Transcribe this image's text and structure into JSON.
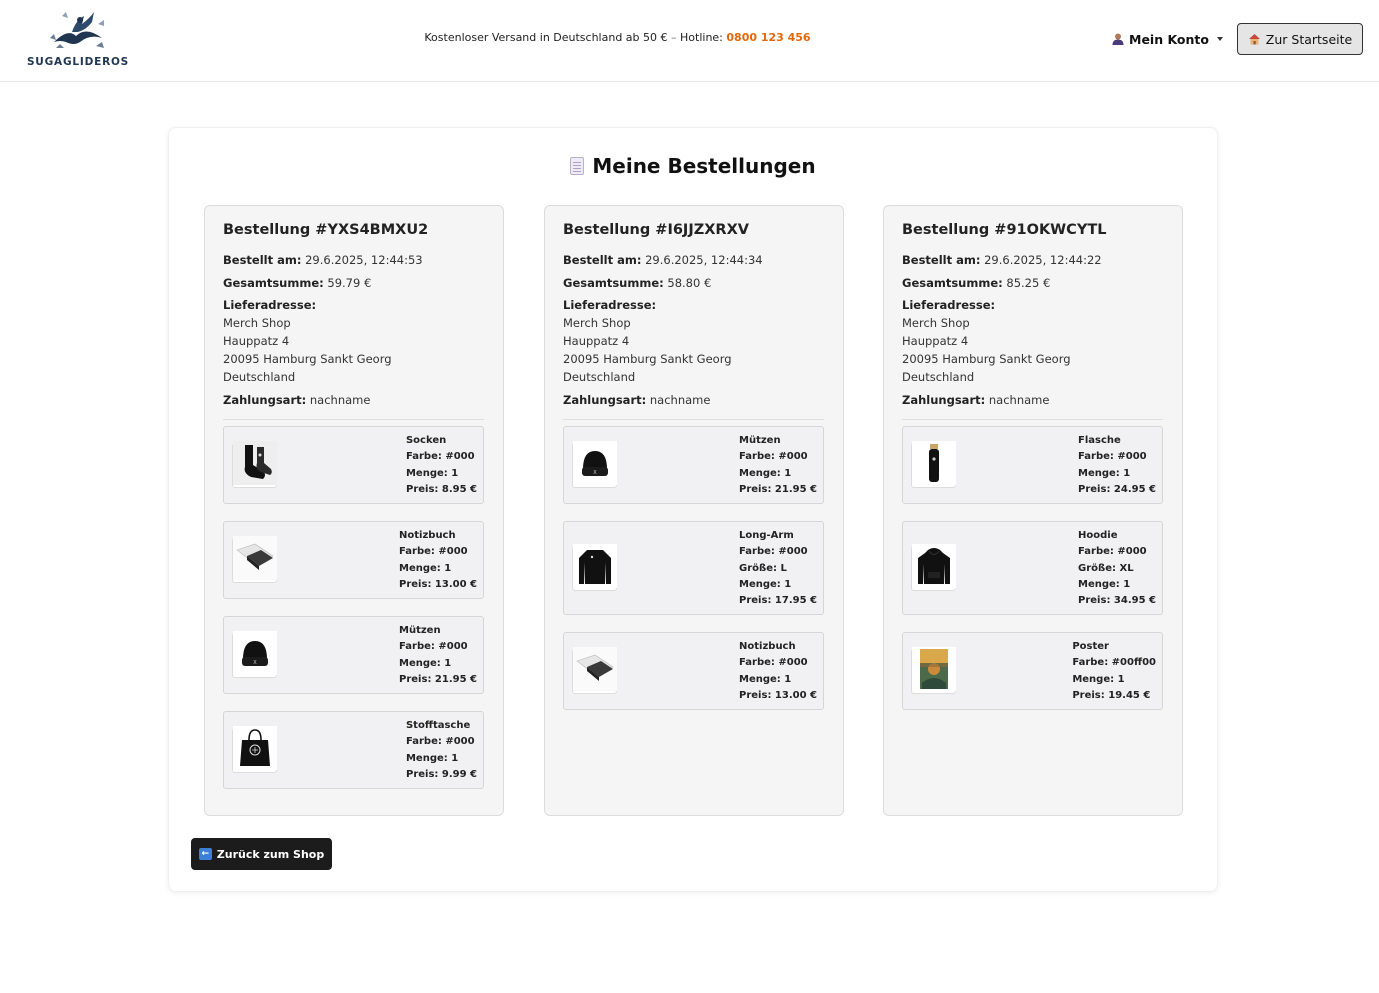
{
  "header": {
    "logo_text": "SUGAGLIDEROS",
    "shipping_text": "Kostenloser Versand in Deutschland ab 50 €",
    "separator": "–",
    "hotline_label": "Hotline:",
    "hotline_number": "0800 123 456",
    "account_label": "Mein Konto",
    "home_button_label": "Zur Startseite"
  },
  "page": {
    "title": "Meine Bestellungen",
    "back_button_label": "Zurück zum Shop"
  },
  "labels": {
    "ordered_at": "Bestellt am:",
    "total": "Gesamtsumme:",
    "address": "Lieferadresse:",
    "payment": "Zahlungsart:"
  },
  "orders": [
    {
      "title": "Bestellung #YXS4BMXU2",
      "ordered_at": "29.6.2025, 12:44:53",
      "total": "59.79 €",
      "address": [
        "Merch Shop",
        "Hauppatz 4",
        "20095 Hamburg Sankt Georg",
        "Deutschland"
      ],
      "payment": "nachname",
      "items": [
        {
          "name": "Socken",
          "farbe": "Farbe: #000",
          "menge": "Menge: 1",
          "preis": "Preis: 8.95 €",
          "icon": "socks-icon"
        },
        {
          "name": "Notizbuch",
          "farbe": "Farbe: #000",
          "menge": "Menge: 1",
          "preis": "Preis: 13.00 €",
          "icon": "notebook-icon"
        },
        {
          "name": "Mützen",
          "farbe": "Farbe: #000",
          "menge": "Menge: 1",
          "preis": "Preis: 21.95 €",
          "icon": "beanie-icon"
        },
        {
          "name": "Stofftasche",
          "farbe": "Farbe: #000",
          "menge": "Menge: 1",
          "preis": "Preis: 9.99 €",
          "icon": "tote-bag-icon"
        }
      ]
    },
    {
      "title": "Bestellung #I6JJZXRXV",
      "ordered_at": "29.6.2025, 12:44:34",
      "total": "58.80 €",
      "address": [
        "Merch Shop",
        "Hauppatz 4",
        "20095 Hamburg Sankt Georg",
        "Deutschland"
      ],
      "payment": "nachname",
      "items": [
        {
          "name": "Mützen",
          "farbe": "Farbe: #000",
          "menge": "Menge: 1",
          "preis": "Preis: 21.95 €",
          "icon": "beanie-icon"
        },
        {
          "name": "Long-Arm",
          "farbe": "Farbe: #000",
          "groesse": "Größe: L",
          "menge": "Menge: 1",
          "preis": "Preis: 17.95 €",
          "icon": "longsleeve-icon"
        },
        {
          "name": "Notizbuch",
          "farbe": "Farbe: #000",
          "menge": "Menge: 1",
          "preis": "Preis: 13.00 €",
          "icon": "notebook-icon"
        }
      ]
    },
    {
      "title": "Bestellung #91OKWCYTL",
      "ordered_at": "29.6.2025, 12:44:22",
      "total": "85.25 €",
      "address": [
        "Merch Shop",
        "Hauppatz 4",
        "20095 Hamburg Sankt Georg",
        "Deutschland"
      ],
      "payment": "nachname",
      "items": [
        {
          "name": "Flasche",
          "farbe": "Farbe: #000",
          "menge": "Menge: 1",
          "preis": "Preis: 24.95 €",
          "icon": "bottle-icon"
        },
        {
          "name": "Hoodie",
          "farbe": "Farbe: #000",
          "groesse": "Größe: XL",
          "menge": "Menge: 1",
          "preis": "Preis: 34.95 €",
          "icon": "hoodie-icon"
        },
        {
          "name": "Poster",
          "farbe": "Farbe: #00ff00",
          "menge": "Menge: 1",
          "preis": "Preis: 19.45 €",
          "icon": "poster-icon"
        }
      ]
    }
  ],
  "colors": {
    "hotline": "#e2680b",
    "back_button": "#1c1c1c",
    "home_button_bg": "#e5e5e5",
    "logo": "#1f3550"
  }
}
